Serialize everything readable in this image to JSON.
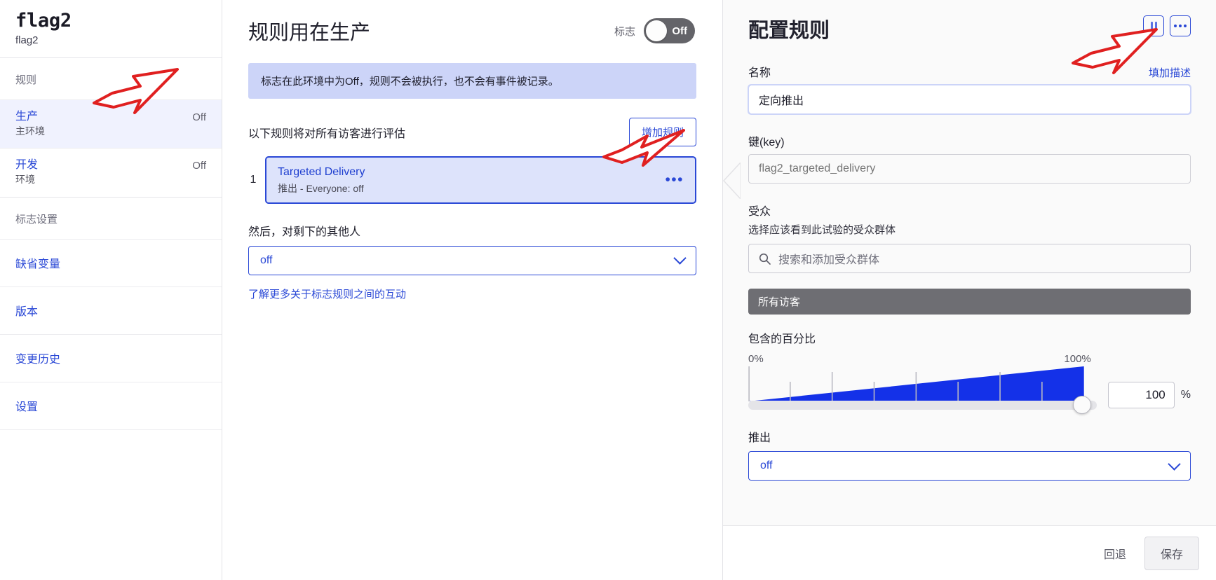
{
  "sidebar": {
    "flag_title": "flag2",
    "flag_key": "flag2",
    "section_rules": "规则",
    "environments": [
      {
        "label": "生产",
        "desc": "主环境",
        "status": "Off"
      },
      {
        "label": "开发",
        "desc": "环境",
        "status": "Off"
      }
    ],
    "section_settings": "标志设置",
    "links": [
      {
        "label": "缺省变量"
      },
      {
        "label": "版本"
      },
      {
        "label": "变更历史"
      },
      {
        "label": "设置"
      }
    ]
  },
  "middle": {
    "title": "规则用在生产",
    "toggle_label": "标志",
    "toggle_state": "Off",
    "notice": "标志在此环境中为Off，规则不会被执行，也不会有事件被记录。",
    "rules_caption": "以下规则将对所有访客进行评估",
    "add_rule_button": "增加规则",
    "rules": [
      {
        "index": "1",
        "name": "Targeted Delivery",
        "meta": "推出 - Everyone: off",
        "menu": "•••"
      }
    ],
    "then_label": "然后，对剩下的其他人",
    "fallthrough_value": "off",
    "learn_more": "了解更多关于标志规则之间的互动"
  },
  "config": {
    "title": "配置规则",
    "pause_icon": "pause-icon",
    "more_icon": "•••",
    "name_label": "名称",
    "add_description_link": "填加描述",
    "name_value": "定向推出",
    "key_label": "键(key)",
    "key_placeholder": "flag2_targeted_delivery",
    "audience_label": "受众",
    "audience_caption": "选择应该看到此试验的受众群体",
    "audience_search_placeholder": "搜索和添加受众群体",
    "all_visitors_bar": "所有访客",
    "percentage_label": "包含的百分比",
    "slider_min_label": "0%",
    "slider_max_label": "100%",
    "percentage_value": "100",
    "percent_sign": "%",
    "rollout_label": "推出",
    "rollout_value": "off",
    "revert_button": "回退",
    "save_button": "保存"
  },
  "colors": {
    "accent": "#2a48d6",
    "notice_bg": "#ccd4f8",
    "rule_card_bg": "#dde3fb",
    "toggle_off": "#646469",
    "slider_fill": "#1431e8",
    "annotation_red": "#e02020"
  },
  "chart_data": {
    "type": "area",
    "title": "包含的百分比",
    "x": [
      0,
      100
    ],
    "values": [
      0,
      100
    ],
    "xlabel": "",
    "ylabel": "",
    "xlim": [
      0,
      100
    ],
    "ylim": [
      0,
      100
    ],
    "grid": true,
    "annotations": [
      "0%",
      "100%"
    ]
  }
}
